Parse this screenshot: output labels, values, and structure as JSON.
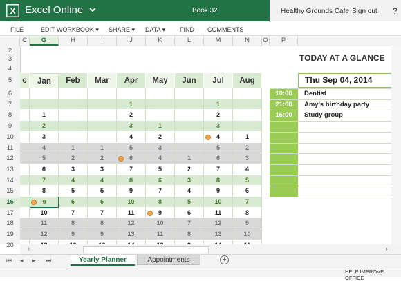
{
  "app": {
    "name": "Excel Online",
    "workbook": "Book 32",
    "company": "Healthy Grounds Cafe",
    "sign_out": "Sign out",
    "help": "?"
  },
  "menu": [
    "FILE",
    "EDIT WORKBOOK",
    "SHARE",
    "DATA",
    "FIND",
    "COMMENTS"
  ],
  "menu_dropdown": [
    "EDIT WORKBOOK",
    "SHARE",
    "DATA"
  ],
  "columns": [
    "C",
    "G",
    "H",
    "I",
    "J",
    "K",
    "L",
    "M",
    "N",
    "O",
    "P"
  ],
  "selected_column": "G",
  "rows": [
    2,
    3,
    4,
    5,
    6,
    7,
    8,
    9,
    10,
    11,
    12,
    13,
    14,
    15,
    16,
    17,
    18,
    19,
    20
  ],
  "selected_row": 16,
  "planner": {
    "partial_header": "c",
    "months": [
      "Jan",
      "Feb",
      "Mar",
      "Apr",
      "May",
      "Jun",
      "Jul",
      "Aug"
    ],
    "rows": [
      [
        "",
        "",
        "",
        "",
        "",
        "",
        "",
        ""
      ],
      [
        "",
        "",
        "",
        "1",
        "",
        "",
        "1",
        ""
      ],
      [
        "1",
        "",
        "",
        "2",
        "",
        "",
        "2",
        ""
      ],
      [
        "2",
        "",
        "",
        "3",
        "1",
        "",
        "3",
        ""
      ],
      [
        "3",
        "",
        "",
        "4",
        "2",
        "",
        "4",
        "1"
      ],
      [
        "4",
        "1",
        "1",
        "5",
        "3",
        "",
        "5",
        "2"
      ],
      [
        "5",
        "2",
        "2",
        "6",
        "4",
        "1",
        "6",
        "3"
      ],
      [
        "6",
        "3",
        "3",
        "7",
        "5",
        "2",
        "7",
        "4"
      ],
      [
        "7",
        "4",
        "4",
        "8",
        "6",
        "3",
        "8",
        "5"
      ],
      [
        "8",
        "5",
        "5",
        "9",
        "7",
        "4",
        "9",
        "6"
      ],
      [
        "9",
        "6",
        "6",
        "10",
        "8",
        "5",
        "10",
        "7"
      ],
      [
        "10",
        "7",
        "7",
        "11",
        "9",
        "6",
        "11",
        "8"
      ],
      [
        "11",
        "8",
        "8",
        "12",
        "10",
        "7",
        "12",
        "9"
      ],
      [
        "12",
        "9",
        "9",
        "13",
        "11",
        "8",
        "13",
        "10"
      ],
      [
        "13",
        "10",
        "10",
        "14",
        "12",
        "9",
        "14",
        "11"
      ]
    ]
  },
  "glance": {
    "title": "TODAY AT A GLANCE",
    "date": "Thu Sep 04, 2014",
    "events": [
      {
        "time": "10:00",
        "name": "Dentist"
      },
      {
        "time": "21:00",
        "name": "Amy's birthday party"
      },
      {
        "time": "16:00",
        "name": "Study group"
      }
    ]
  },
  "sheets": [
    "Yearly Planner",
    "Appointments"
  ],
  "active_sheet": "Yearly Planner",
  "add_sheet": "+",
  "status": {
    "help_improve": "HELP IMPROVE OFFICE"
  },
  "colors": {
    "brand": "#217346",
    "header_green": "#e2efda",
    "band_green": "#d9ead3",
    "band_gray": "#d9d9d9",
    "event_green": "#9acb55",
    "dot_orange": "#f0a848"
  }
}
